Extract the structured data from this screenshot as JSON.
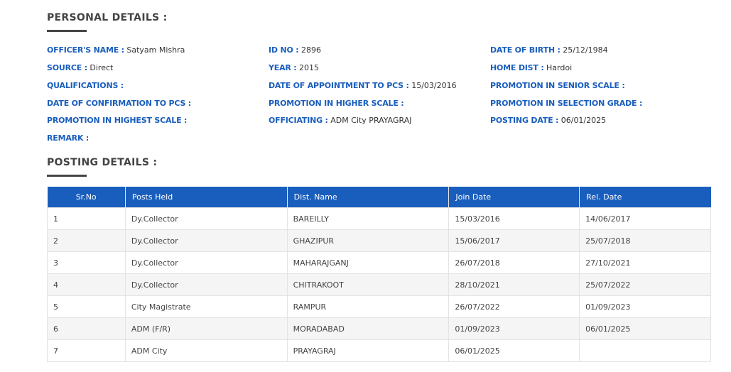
{
  "personal": {
    "title": "PERSONAL DETAILS :",
    "fields": [
      {
        "label": "OFFICER'S NAME :",
        "value": "Satyam Mishra"
      },
      {
        "label": "ID NO :",
        "value": "2896"
      },
      {
        "label": "DATE OF BIRTH :",
        "value": "25/12/1984"
      },
      {
        "label": "SOURCE :",
        "value": "Direct"
      },
      {
        "label": "YEAR :",
        "value": "2015"
      },
      {
        "label": "HOME DIST :",
        "value": "Hardoi"
      },
      {
        "label": "QUALIFICATIONS :",
        "value": ""
      },
      {
        "label": "DATE OF APPOINTMENT TO PCS :",
        "value": "15/03/2016"
      },
      {
        "label": "PROMOTION IN SENIOR SCALE :",
        "value": ""
      },
      {
        "label": "DATE OF CONFIRMATION TO PCS :",
        "value": ""
      },
      {
        "label": "PROMOTION IN HIGHER SCALE :",
        "value": ""
      },
      {
        "label": "PROMOTION IN SELECTION GRADE :",
        "value": ""
      },
      {
        "label": "PROMOTION IN HIGHEST SCALE :",
        "value": ""
      },
      {
        "label": "OFFICIATING :",
        "value": "ADM City PRAYAGRAJ"
      },
      {
        "label": "POSTING DATE :",
        "value": "06/01/2025"
      },
      {
        "label": "REMARK :",
        "value": ""
      }
    ]
  },
  "posting": {
    "title": "POSTING DETAILS :",
    "columns": [
      "Sr.No",
      "Posts Held",
      "Dist. Name",
      "Join Date",
      "Rel. Date"
    ],
    "rows": [
      [
        "1",
        "Dy.Collector",
        "BAREILLY",
        "15/03/2016",
        "14/06/2017"
      ],
      [
        "2",
        "Dy.Collector",
        "GHAZIPUR",
        "15/06/2017",
        "25/07/2018"
      ],
      [
        "3",
        "Dy.Collector",
        "MAHARAJGANJ",
        "26/07/2018",
        "27/10/2021"
      ],
      [
        "4",
        "Dy.Collector",
        "CHITRAKOOT",
        "28/10/2021",
        "25/07/2022"
      ],
      [
        "5",
        "City Magistrate",
        "RAMPUR",
        "26/07/2022",
        "01/09/2023"
      ],
      [
        "6",
        "ADM (F/R)",
        "MORADABAD",
        "01/09/2023",
        "06/01/2025"
      ],
      [
        "7",
        "ADM City",
        "PRAYAGRAJ",
        "06/01/2025",
        ""
      ]
    ]
  },
  "colors": {
    "accent": "#1a5ebd",
    "heading": "#444444",
    "row_alt": "#f5f5f5"
  }
}
